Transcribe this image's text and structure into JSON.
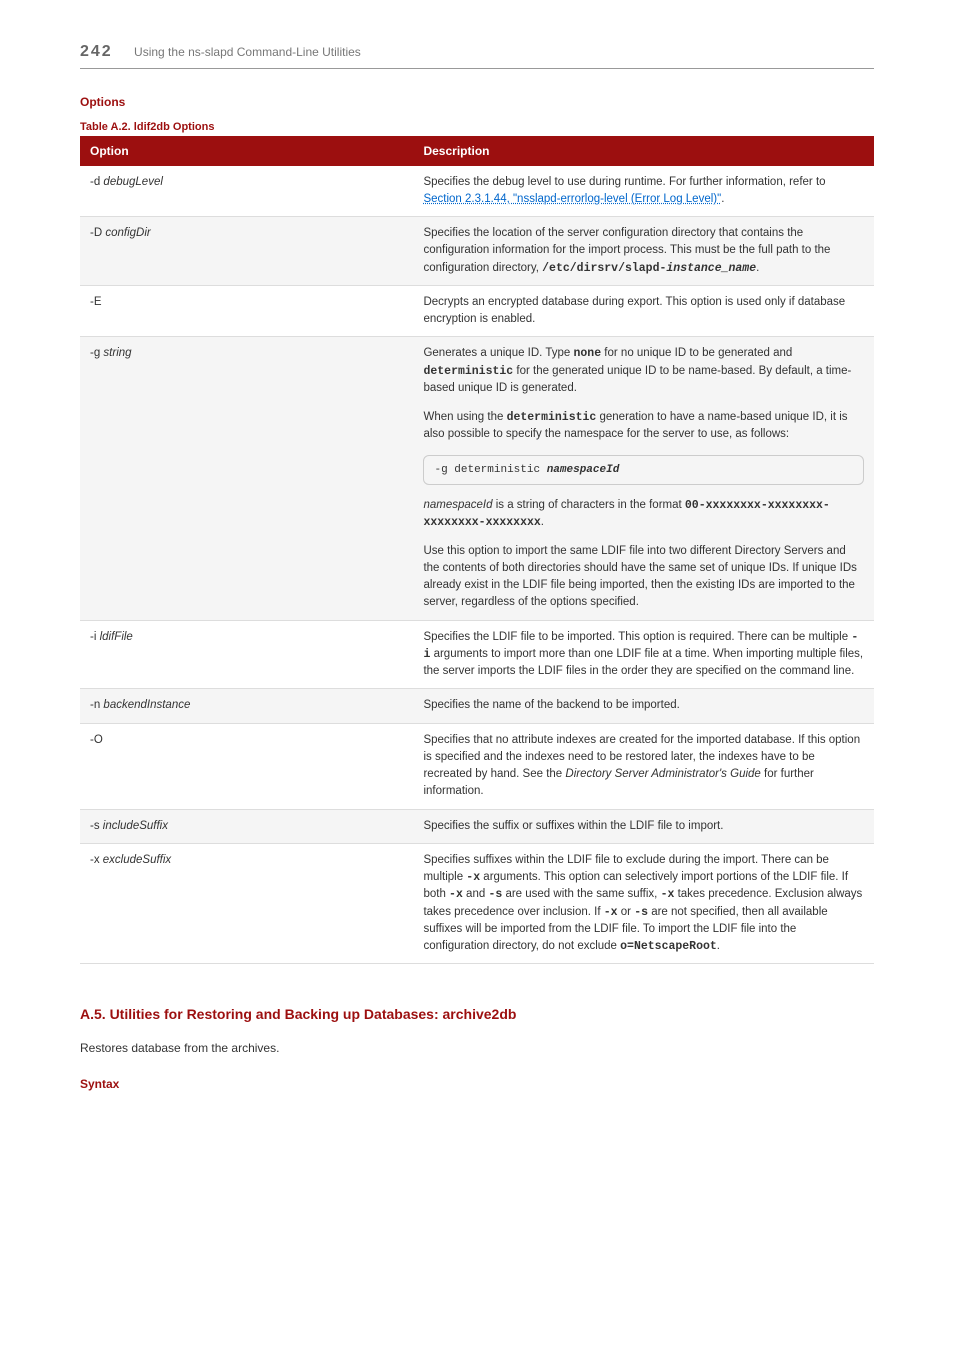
{
  "header": {
    "page_number": "242",
    "running_title": "Using the ns-slapd Command-Line Utilities"
  },
  "section_options_heading": "Options",
  "table_caption": "Table A.2. ldif2db Options",
  "table_headers": {
    "col1": "Option",
    "col2": "Description"
  },
  "rows": {
    "d": {
      "opt_prefix": "-d ",
      "opt_arg": "debugLevel",
      "desc_pre": "Specifies the debug level to use during runtime. For further information, refer to ",
      "link1": "Section 2.3.1.44, \"nsslapd-errorlog-level (Error Log Level)\"",
      "desc_post": "."
    },
    "D": {
      "opt_prefix": "-D ",
      "opt_arg": "configDir",
      "p1": "Specifies the location of the server configuration directory that contains the configuration information for the import process. This must be the full path to the configuration directory, ",
      "path_pre": "/etc/dirsrv/slapd-",
      "path_arg": "instance_name",
      "path_post": "."
    },
    "E": {
      "opt_prefix": "-E",
      "p1": "Decrypts an encrypted database during export. This option is used only if database encryption is enabled."
    },
    "g": {
      "opt_prefix": "-g ",
      "opt_arg": "string",
      "p1a": "Generates a unique ID. Type ",
      "none": "none",
      "p1b": " for no unique ID to be generated and ",
      "det1": "deterministic",
      "p1c": " for the generated unique ID to be name-based. By default, a time-based unique ID is generated.",
      "p2a": "When using the ",
      "det2": "deterministic",
      "p2b": " generation to have a name-based unique ID, it is also possible to specify the namespace for the server to use, as follows:",
      "code_pre": "-g deterministic ",
      "code_arg": "namespaceId",
      "p3a": "namespaceId",
      "p3b": " is a string of characters in the format ",
      "fmt": "00-xxxxxxxx-xxxxxxxx-xxxxxxxx-xxxxxxxx",
      "p3c": ".",
      "p4": "Use this option to import the same LDIF file into two different Directory Servers and the contents of both directories should have the same set of unique IDs. If unique IDs already exist in the LDIF file being imported, then the existing IDs are imported to the server, regardless of the options specified."
    },
    "i": {
      "opt_prefix": "-i ",
      "opt_arg": "ldifFile",
      "p1a": "Specifies the LDIF file to be imported. This option is required. There can be multiple ",
      "flag": "-i",
      "p1b": " arguments to import more than one LDIF file at a time. When importing multiple files, the server imports the LDIF files in the order they are specified on the command line."
    },
    "n": {
      "opt_prefix": "-n ",
      "opt_arg": "backendInstance",
      "p1": "Specifies the name of the backend to be imported."
    },
    "O": {
      "opt_prefix": "-O",
      "p1a": "Specifies that no attribute indexes are created for the imported database. If this option is specified and the indexes need to be restored later, the indexes have to be recreated by hand. See the ",
      "guide": "Directory Server Administrator's Guide",
      "p1b": " for further information."
    },
    "s": {
      "opt_prefix": "-s ",
      "opt_arg": "includeSuffix",
      "p1": "Specifies the suffix or suffixes within the LDIF file to import."
    },
    "x": {
      "opt_prefix": "-x ",
      "opt_arg": "excludeSuffix",
      "p1a": "Specifies suffixes within the LDIF file to exclude during the import. There can be multiple ",
      "x1": "-x",
      "p1b": " arguments. This option can selectively import portions of the LDIF file. If both ",
      "x2": "-x",
      "p1c": " and ",
      "s1": "-s",
      "p1d": " are used with the same suffix, ",
      "x3": "-x",
      "p1e": " takes precedence. Exclusion always takes precedence over inclusion. If ",
      "x4": "-x",
      "p1f": " or ",
      "s2": "-s",
      "p1g": " are not specified, then all available suffixes will be imported from the LDIF file. To import the LDIF file into the configuration directory, do not exclude ",
      "root": "o=NetscapeRoot",
      "p1h": "."
    }
  },
  "section_a5": {
    "title": "A.5. Utilities for Restoring and Backing up Databases: archive2db",
    "body": "Restores database from the archives."
  },
  "syntax_heading": "Syntax"
}
